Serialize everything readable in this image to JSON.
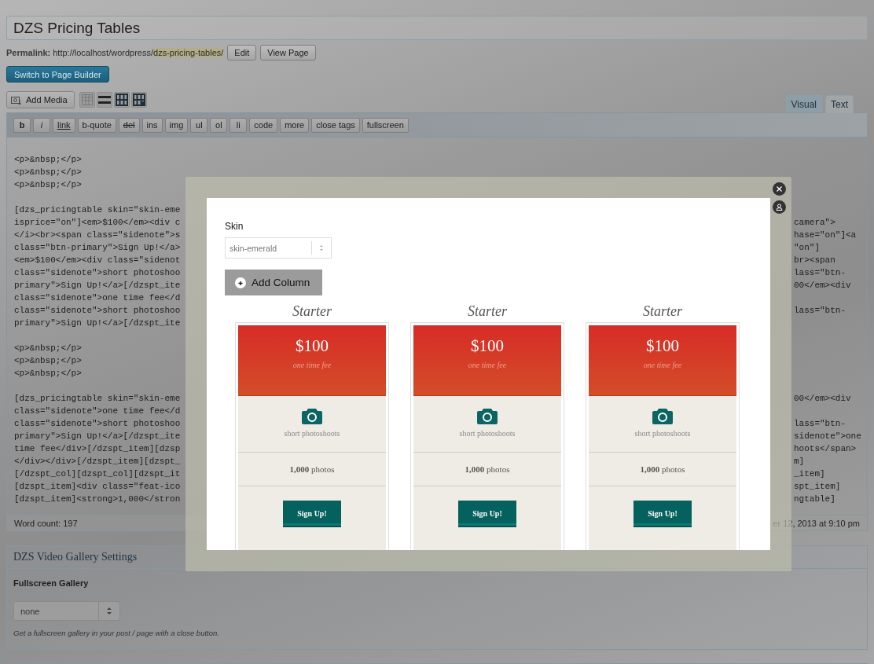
{
  "title_field": {
    "value": "DZS Pricing Tables"
  },
  "permalink": {
    "label": "Permalink:",
    "url_base": "http://localhost/wordpress/",
    "slug": "dzs-pricing-tables/",
    "buttons": [
      "Edit",
      "View Page"
    ]
  },
  "page_builder_button": "Switch to Page Builder",
  "media_button": "Add Media",
  "editor_tabs": [
    {
      "label": "Visual",
      "selected": false
    },
    {
      "label": "Text",
      "selected": true
    }
  ],
  "quicktags": [
    {
      "label": "b",
      "kind": "bold"
    },
    {
      "label": "i",
      "kind": "italic"
    },
    {
      "label": "link",
      "kind": "link"
    },
    {
      "label": "b-quote",
      "kind": "plain"
    },
    {
      "label": "del",
      "kind": "strike"
    },
    {
      "label": "ins",
      "kind": "plain"
    },
    {
      "label": "img",
      "kind": "plain"
    },
    {
      "label": "ul",
      "kind": "plain"
    },
    {
      "label": "ol",
      "kind": "plain"
    },
    {
      "label": "li",
      "kind": "plain"
    },
    {
      "label": "code",
      "kind": "plain"
    },
    {
      "label": "more",
      "kind": "plain"
    },
    {
      "label": "close tags",
      "kind": "plain"
    },
    {
      "label": "fullscreen",
      "kind": "plain"
    }
  ],
  "code_blocks": [
    [
      {
        "left": "<p>&nbsp;</p>"
      },
      {
        "left": "<p>&nbsp;</p>"
      },
      {
        "left": "<p>&nbsp;</p>"
      }
    ],
    [
      {
        "left": "[dzs_pricingtable skin=\"skin-eme"
      },
      {
        "left": "isprice=\"on\"]<em>$100</em><div c",
        "right": "camera\">"
      },
      {
        "left": "</i><br><span class=\"sidenote\">s",
        "right": "hase=\"on\"]<a"
      },
      {
        "left": "class=\"btn-primary\">Sign Up!</a>",
        "right": "\"on\"]"
      },
      {
        "left": "<em>$100</em><div class=\"sidenot",
        "right": "br><span"
      },
      {
        "left": "class=\"sidenote\">short photoshoo",
        "right": "lass=\"btn-"
      },
      {
        "left": "primary\">Sign Up!</a>[/dzspt_ite",
        "right": "00</em><div"
      },
      {
        "left": "class=\"sidenote\">one time fee</d"
      },
      {
        "left": "class=\"sidenote\">short photoshoo",
        "right": "lass=\"btn-"
      },
      {
        "left": "primary\">Sign Up!</a>[/dzspt_ite"
      }
    ],
    [
      {
        "left": "<p>&nbsp;</p>"
      },
      {
        "left": "<p>&nbsp;</p>"
      },
      {
        "left": "<p>&nbsp;</p>"
      }
    ],
    [
      {
        "left": "[dzs_pricingtable skin=\"skin-eme",
        "right": "00</em><div"
      },
      {
        "left": "class=\"sidenote\">one time fee</d"
      },
      {
        "left": "class=\"sidenote\">short photoshoo",
        "right": "lass=\"btn-"
      },
      {
        "left": "primary\">Sign Up!</a>[/dzspt_ite",
        "right": "sidenote\">one"
      },
      {
        "left": "time fee</div>[/dzspt_item][dzsp",
        "right": "hoots</span>"
      },
      {
        "left": "</div></div>[/dzspt_item][dzspt_",
        "right": "m]"
      },
      {
        "left": "[/dzspt_col][dzspt_col][dzspt_it",
        "right": "_item]"
      },
      {
        "left": "[dzspt_item]<div class=\"feat-ico",
        "right": "spt_item]"
      },
      {
        "left": "[dzspt_item]<strong>1,000</stron",
        "right": "ngtable]"
      }
    ]
  ],
  "status": {
    "word_count": "Word count: 197",
    "last_edited": "er 12, 2013 at 9:10 pm"
  },
  "metabox": {
    "title": "DZS Video Gallery Settings",
    "field_label": "Fullscreen Gallery",
    "select_value": "none",
    "hint": "Get a fullscreen gallery in your post / page with a close button."
  },
  "modal": {
    "skin_label": "Skin",
    "skin_value": "skin-emerald",
    "add_column": "Add Column",
    "columns": [
      {
        "title": "Starter",
        "price": "$100",
        "price_note": "one time fee",
        "feature": "short photoshoots",
        "count": "**1,000** photos",
        "button": "Sign Up!"
      },
      {
        "title": "Starter",
        "price": "$100",
        "price_note": "one time fee",
        "feature": "short photoshoots",
        "count": "**1,000** photos",
        "button": "Sign Up!"
      },
      {
        "title": "Starter",
        "price": "$100",
        "price_note": "one time fee",
        "feature": "short photoshoots",
        "count": "**1,000** photos",
        "button": "Sign Up!"
      }
    ]
  }
}
